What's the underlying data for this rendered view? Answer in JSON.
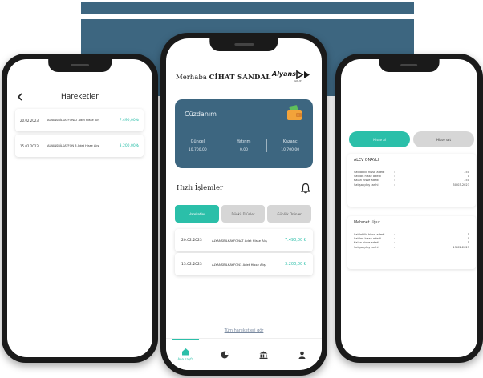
{
  "colors": {
    "brand_blue": "#3d6680",
    "accent_green": "#2bbfa9",
    "tab_gray": "#d6d6d6"
  },
  "left_screen": {
    "back_icon": "chevron-left-icon",
    "title": "Hareketler",
    "transactions": [
      {
        "date": "20.02.2023",
        "desc": "ALYANSBİLKAYFONAT Adet Hisse Alış",
        "amount": "7.490,00 ₺"
      },
      {
        "date": "15.02.2023",
        "desc": "ALYANSBİLKAYFON 3 Adet Hisse Alış",
        "amount": "3.200,00 ₺"
      }
    ]
  },
  "center_screen": {
    "greeting": "Merhaba",
    "user_name": "CİHAT SANDAL",
    "logo_text": "Alyans",
    "logo_sub": "GRUP",
    "wallet": {
      "title": "Cüzdanım",
      "icon": "wallet-icon",
      "cols": [
        {
          "label": "Güncel",
          "value": "10.700,00"
        },
        {
          "label": "Yatırım",
          "value": "0,00"
        },
        {
          "label": "Kazanç",
          "value": "10.700,00"
        }
      ]
    },
    "quick_title": "Hızlı İşlemler",
    "bell_icon": "bell-icon",
    "tabs": [
      "Hareketler",
      "Dünkü Ürünler",
      "Günlük Ürünler"
    ],
    "transactions": [
      {
        "date": "20.02.2023",
        "desc": "ALYANSBİLKAYFONAT Adet Hisse Alış",
        "amount": "7.490,00 ₺"
      },
      {
        "date": "13.02.2023",
        "desc": "ALYANSBİLKAYFON3 Adet Hisse Alış",
        "amount": "3.200,00 ₺"
      }
    ],
    "all_link": "Tüm hareketleri gör",
    "nav": [
      {
        "icon": "home-icon",
        "label": "Ana sayfa"
      },
      {
        "icon": "chart-icon",
        "label": ""
      },
      {
        "icon": "bank-icon",
        "label": ""
      },
      {
        "icon": "user-icon",
        "label": ""
      }
    ]
  },
  "right_screen": {
    "tabs": [
      "Hisse al",
      "Hisse sat"
    ],
    "cards": [
      {
        "name": "ALEV ONAYLI",
        "rows": [
          {
            "k": "Satılabilir hisse adedi",
            "v": "150"
          },
          {
            "k": "Satılan hisse adedi",
            "v": "0"
          },
          {
            "k": "Kalan hisse adedi",
            "v": "150"
          },
          {
            "k": "Satışa çıkış tarihi",
            "v": "30.03.2023"
          }
        ]
      },
      {
        "name": "Mehmet Uğur",
        "rows": [
          {
            "k": "Satılabilir hisse adedi",
            "v": "5"
          },
          {
            "k": "Satılan hisse adedi",
            "v": "0"
          },
          {
            "k": "Kalan hisse adedi",
            "v": "5"
          },
          {
            "k": "Satışa çıkış tarihi",
            "v": "13.02.2023"
          }
        ]
      }
    ]
  }
}
